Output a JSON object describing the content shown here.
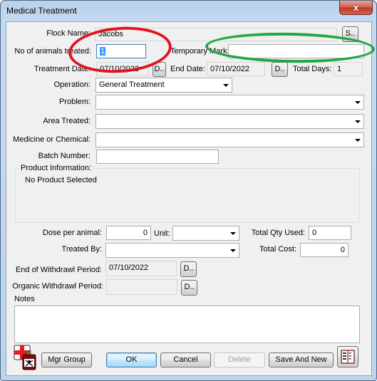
{
  "window": {
    "title": "Medical Treatment",
    "close_glyph": "x"
  },
  "form": {
    "flock_name": {
      "label": "Flock Name:",
      "value": "Jacobs",
      "button": "S.."
    },
    "animals_treated": {
      "label": "No of animals treated:",
      "value": "1"
    },
    "temporary_mark": {
      "label": "Temporary Mark:",
      "value": ""
    },
    "treatment_date": {
      "label": "Treatment Date:",
      "value": "07/10/2022",
      "button": "D.."
    },
    "end_date": {
      "label": "End Date:",
      "value": "07/10/2022",
      "button": "D.."
    },
    "total_days": {
      "label": "Total Days:",
      "value": "1"
    },
    "operation": {
      "label": "Operation:",
      "value": "General Treatment"
    },
    "problem": {
      "label": "Problem:",
      "value": ""
    },
    "area_treated": {
      "label": "Area Treated:",
      "value": ""
    },
    "medicine": {
      "label": "Medicine or Chemical:",
      "value": ""
    },
    "batch_number": {
      "label": "Batch Number:",
      "value": ""
    },
    "product_info": {
      "label": "Product Information:",
      "value": "No Product Selected"
    },
    "dose_per_animal": {
      "label": "Dose per animal:",
      "value": "0"
    },
    "unit": {
      "label": "Unit:",
      "value": ""
    },
    "total_qty_used": {
      "label": "Total Qty Used:",
      "value": "0"
    },
    "treated_by": {
      "label": "Treated By:",
      "value": ""
    },
    "total_cost": {
      "label": "Total Cost:",
      "value": "0"
    },
    "end_withdrawal": {
      "label": "End of Withdrawl Period:",
      "value": "07/10/2022",
      "button": "D.."
    },
    "organic_withdrawal": {
      "label": "Organic Withdrawl Period:",
      "value": "",
      "button": "D.."
    },
    "notes": {
      "label": "Notes",
      "value": ""
    }
  },
  "buttons": {
    "mgr_group": "Mgr Group",
    "ok": "OK",
    "cancel": "Cancel",
    "delete": "Delete",
    "save_and_new": "Save And New"
  },
  "icons": {
    "medicine": "medicine-poison-icon",
    "report": "report-book-icon"
  },
  "colors": {
    "annotation_red": "#e0141e",
    "annotation_green": "#22a845",
    "selection": "#3399ff",
    "focus_border": "#3c7fb1"
  }
}
